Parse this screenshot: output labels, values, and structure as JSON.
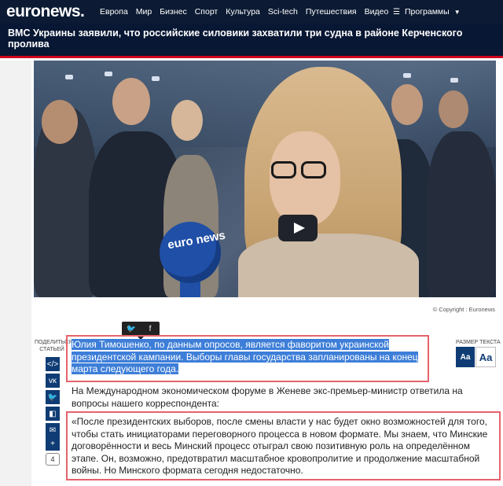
{
  "header": {
    "logo": "euronews.",
    "nav": [
      "Европа",
      "Мир",
      "Бизнес",
      "Спорт",
      "Культура",
      "Sci-tech",
      "Путешествия",
      "Видео"
    ],
    "programs": "Программы"
  },
  "breaking": {
    "headline": "ВМС Украины заявили, что российские силовики захватили три судна в районе Керченского пролива"
  },
  "video": {
    "mic_logo": "euro news"
  },
  "copyright": "© Copyright :   Euronews",
  "share": {
    "label_line1": "ПОДЕЛИТЬСЯ",
    "label_line2": "СТАТЬЕЙ",
    "comments_count": "4"
  },
  "text_size": {
    "label": "РАЗМЕР ТЕКСТА",
    "small": "Aa",
    "large": "Aa"
  },
  "article": {
    "lead": "Юлия Тимошенко, по данным опросов, является фаворитом украинской президентской кампании. Выборы главы государства запланированы на конец марта следующего года.",
    "p1": "На Международном экономическом форуме в Женеве экс-премьер-министр ответила на вопросы нашего корреспондента:",
    "quote": "«После президентских выборов, после смены власти у нас будет окно возможностей для того, чтобы стать инициаторами переговорного процесса в новом формате. Мы знаем, что Минские договорённости и весь Минский процесс отыграл свою позитивную роль на определённом этапе. Он, возможно, предотвратил масштабное кровопролитие и продолжение масштабной войны. Но Минского формата сегодня недостаточно."
  },
  "colors": {
    "nav_bg": "#0c1b33",
    "breaking_bg": "#081733",
    "accent_red": "#d0021b",
    "highlight_blue": "#3d7ed8",
    "share_blue": "#0f3c74",
    "annotation_red": "#e5636b"
  }
}
